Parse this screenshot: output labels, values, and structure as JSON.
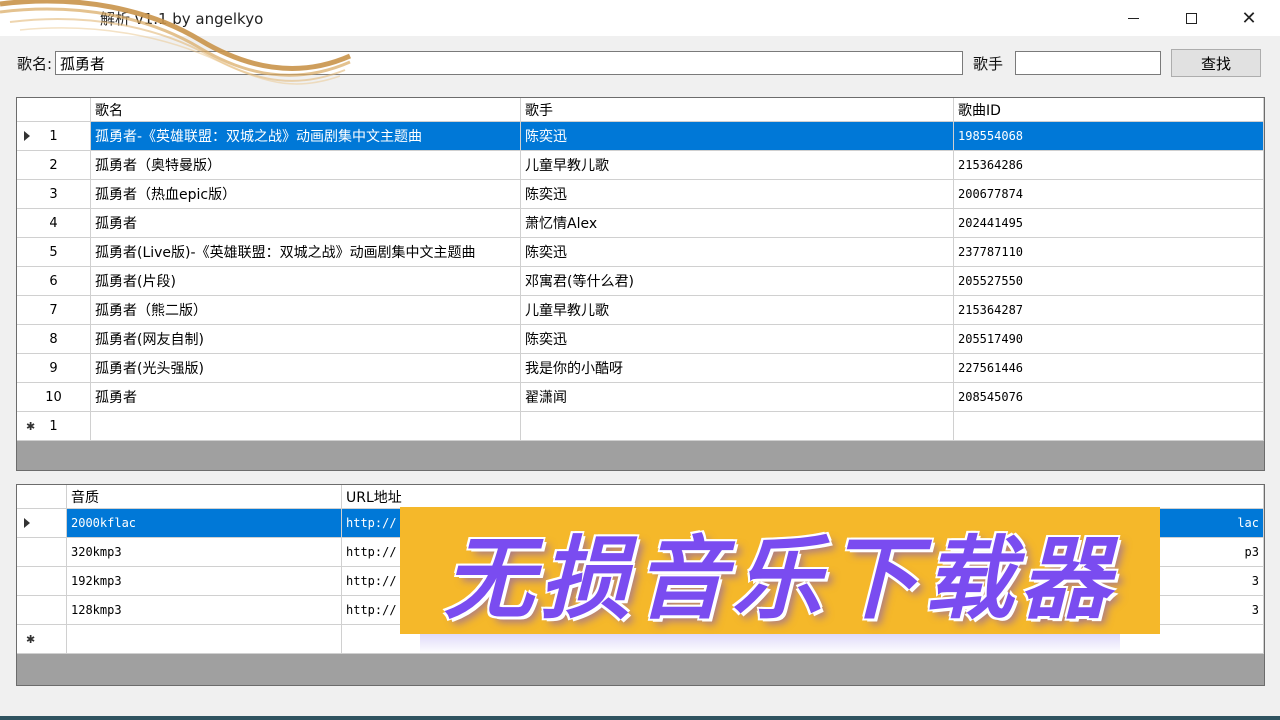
{
  "window": {
    "title": "解析 v1.1 by angelkyo"
  },
  "search": {
    "song_label": "歌名:",
    "song_value": "孤勇者",
    "singer_label": "歌手",
    "singer_value": "",
    "search_button": "查找"
  },
  "songs": {
    "headers": [
      "歌名",
      "歌手",
      "歌曲ID"
    ],
    "rows": [
      {
        "n": "1",
        "name": "孤勇者-《英雄联盟：双城之战》动画剧集中文主题曲",
        "singer": "陈奕迅",
        "id": "198554068"
      },
      {
        "n": "2",
        "name": "孤勇者（奥特曼版）",
        "singer": "儿童早教儿歌",
        "id": "215364286"
      },
      {
        "n": "3",
        "name": "孤勇者（热血epic版）",
        "singer": "陈奕迅",
        "id": "200677874"
      },
      {
        "n": "4",
        "name": "孤勇者",
        "singer": "萧忆情Alex",
        "id": "202441495"
      },
      {
        "n": "5",
        "name": "孤勇者(Live版)-《英雄联盟：双城之战》动画剧集中文主题曲",
        "singer": "陈奕迅",
        "id": "237787110"
      },
      {
        "n": "6",
        "name": "孤勇者(片段)",
        "singer": "邓寓君(等什么君)",
        "id": "205527550"
      },
      {
        "n": "7",
        "name": "孤勇者（熊二版）",
        "singer": "儿童早教儿歌",
        "id": "215364287"
      },
      {
        "n": "8",
        "name": "孤勇者(网友自制)",
        "singer": "陈奕迅",
        "id": "205517490"
      },
      {
        "n": "9",
        "name": "孤勇者(光头强版)",
        "singer": "我是你的小酷呀",
        "id": "227561446"
      },
      {
        "n": "10",
        "name": "孤勇者",
        "singer": "翟潇闻",
        "id": "208545076"
      }
    ],
    "new_row_number": "1"
  },
  "quality": {
    "headers": [
      "音质",
      "URL地址"
    ],
    "rows": [
      {
        "quality": "2000kflac",
        "url": "http://",
        "tail": "lac"
      },
      {
        "quality": "320kmp3",
        "url": "http://",
        "tail": "p3"
      },
      {
        "quality": "192kmp3",
        "url": "http://",
        "tail": "3"
      },
      {
        "quality": "128kmp3",
        "url": "http://",
        "tail": "3"
      }
    ]
  },
  "banner": {
    "text": "无损音乐下载器"
  },
  "colors": {
    "selection": "#0078d7",
    "banner_bg": "#f5b82a",
    "banner_text": "#7a4cf0"
  }
}
